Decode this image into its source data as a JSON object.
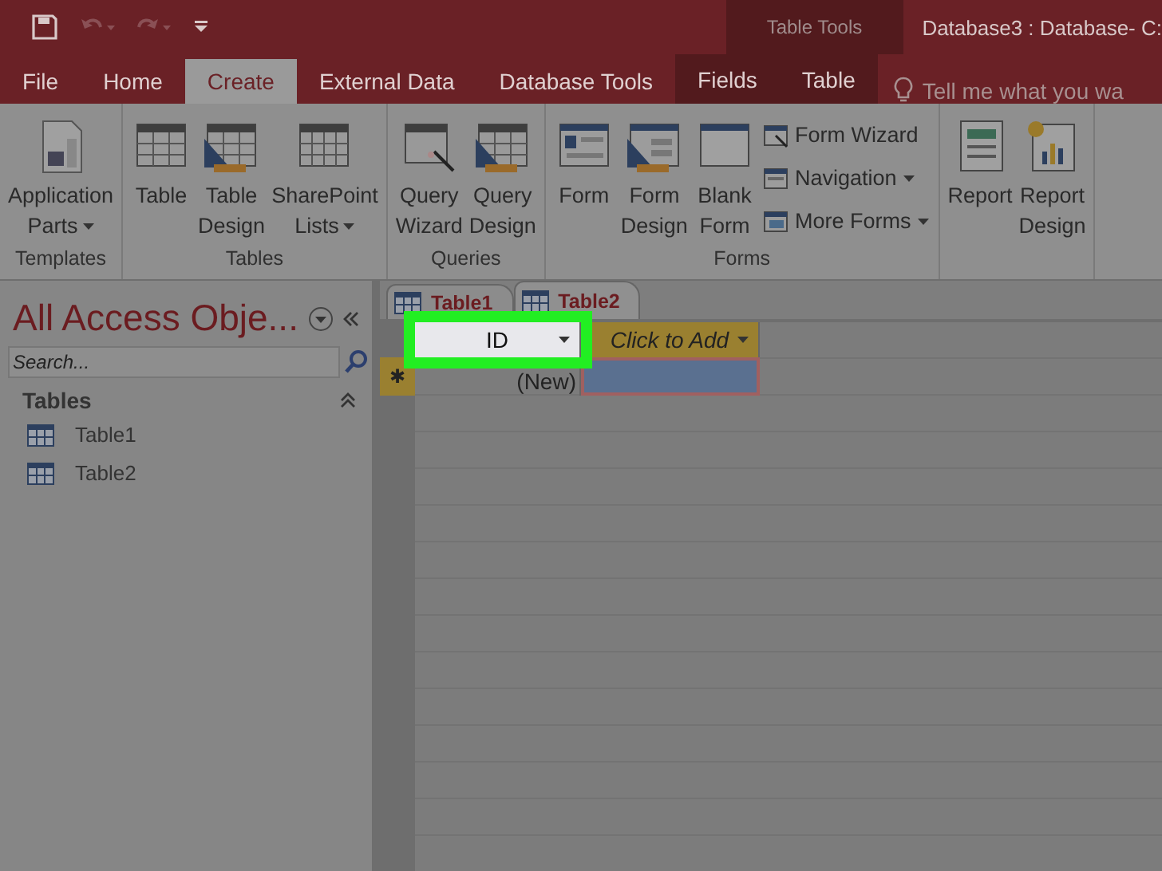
{
  "title_bar": {
    "context_label": "Table Tools",
    "title": "Database3 : Database- C:"
  },
  "tabs": [
    {
      "label": "File",
      "selected": false,
      "contextual": false
    },
    {
      "label": "Home",
      "selected": false,
      "contextual": false
    },
    {
      "label": "Create",
      "selected": true,
      "contextual": false
    },
    {
      "label": "External Data",
      "selected": false,
      "contextual": false
    },
    {
      "label": "Database Tools",
      "selected": false,
      "contextual": false
    },
    {
      "label": "Fields",
      "selected": false,
      "contextual": true
    },
    {
      "label": "Table",
      "selected": false,
      "contextual": true
    }
  ],
  "tell_me": {
    "placeholder": "Tell me what you wa"
  },
  "ribbon_groups": [
    {
      "label": "Templates",
      "commands": [
        {
          "kind": "large",
          "lines": [
            "Application",
            "Parts"
          ],
          "dropdown": true
        }
      ]
    },
    {
      "label": "Tables",
      "commands": [
        {
          "kind": "large",
          "lines": [
            "Table"
          ],
          "dropdown": false
        },
        {
          "kind": "large",
          "lines": [
            "Table",
            "Design"
          ],
          "dropdown": false
        },
        {
          "kind": "large",
          "lines": [
            "SharePoint",
            "Lists"
          ],
          "dropdown": true
        }
      ]
    },
    {
      "label": "Queries",
      "commands": [
        {
          "kind": "large",
          "lines": [
            "Query",
            "Wizard"
          ],
          "dropdown": false
        },
        {
          "kind": "large",
          "lines": [
            "Query",
            "Design"
          ],
          "dropdown": false
        }
      ]
    },
    {
      "label": "Forms",
      "commands": [
        {
          "kind": "large",
          "lines": [
            "Form"
          ],
          "dropdown": false
        },
        {
          "kind": "large",
          "lines": [
            "Form",
            "Design"
          ],
          "dropdown": false
        },
        {
          "kind": "large",
          "lines": [
            "Blank",
            "Form"
          ],
          "dropdown": false
        },
        {
          "kind": "small",
          "lines": [
            "Form Wizard"
          ],
          "dropdown": false
        },
        {
          "kind": "small",
          "lines": [
            "Navigation"
          ],
          "dropdown": true
        },
        {
          "kind": "small",
          "lines": [
            "More Forms"
          ],
          "dropdown": true
        }
      ]
    },
    {
      "commands": [
        {
          "kind": "large",
          "lines": [
            "Report"
          ],
          "dropdown": false
        },
        {
          "kind": "large",
          "lines": [
            "Report",
            "Design"
          ],
          "dropdown": false
        }
      ]
    }
  ],
  "nav_pane": {
    "title": "All Access Obje...",
    "search": {
      "placeholder": "Search..."
    },
    "section": {
      "label": "Tables",
      "expanded": true,
      "items": [
        {
          "label": "Table1"
        },
        {
          "label": "Table2"
        }
      ]
    }
  },
  "document_tabs": [
    {
      "label": "Table1",
      "selected": false
    },
    {
      "label": "Table2",
      "selected": true
    }
  ],
  "datasheet": {
    "columns": [
      {
        "label": "ID",
        "highlighted": true
      },
      {
        "label": "Click to Add",
        "highlighted": false
      }
    ],
    "new_row": {
      "marker": "✱",
      "cells": [
        {
          "text": "(New)",
          "selected": false
        },
        {
          "text": "",
          "selected": true
        }
      ]
    }
  }
}
